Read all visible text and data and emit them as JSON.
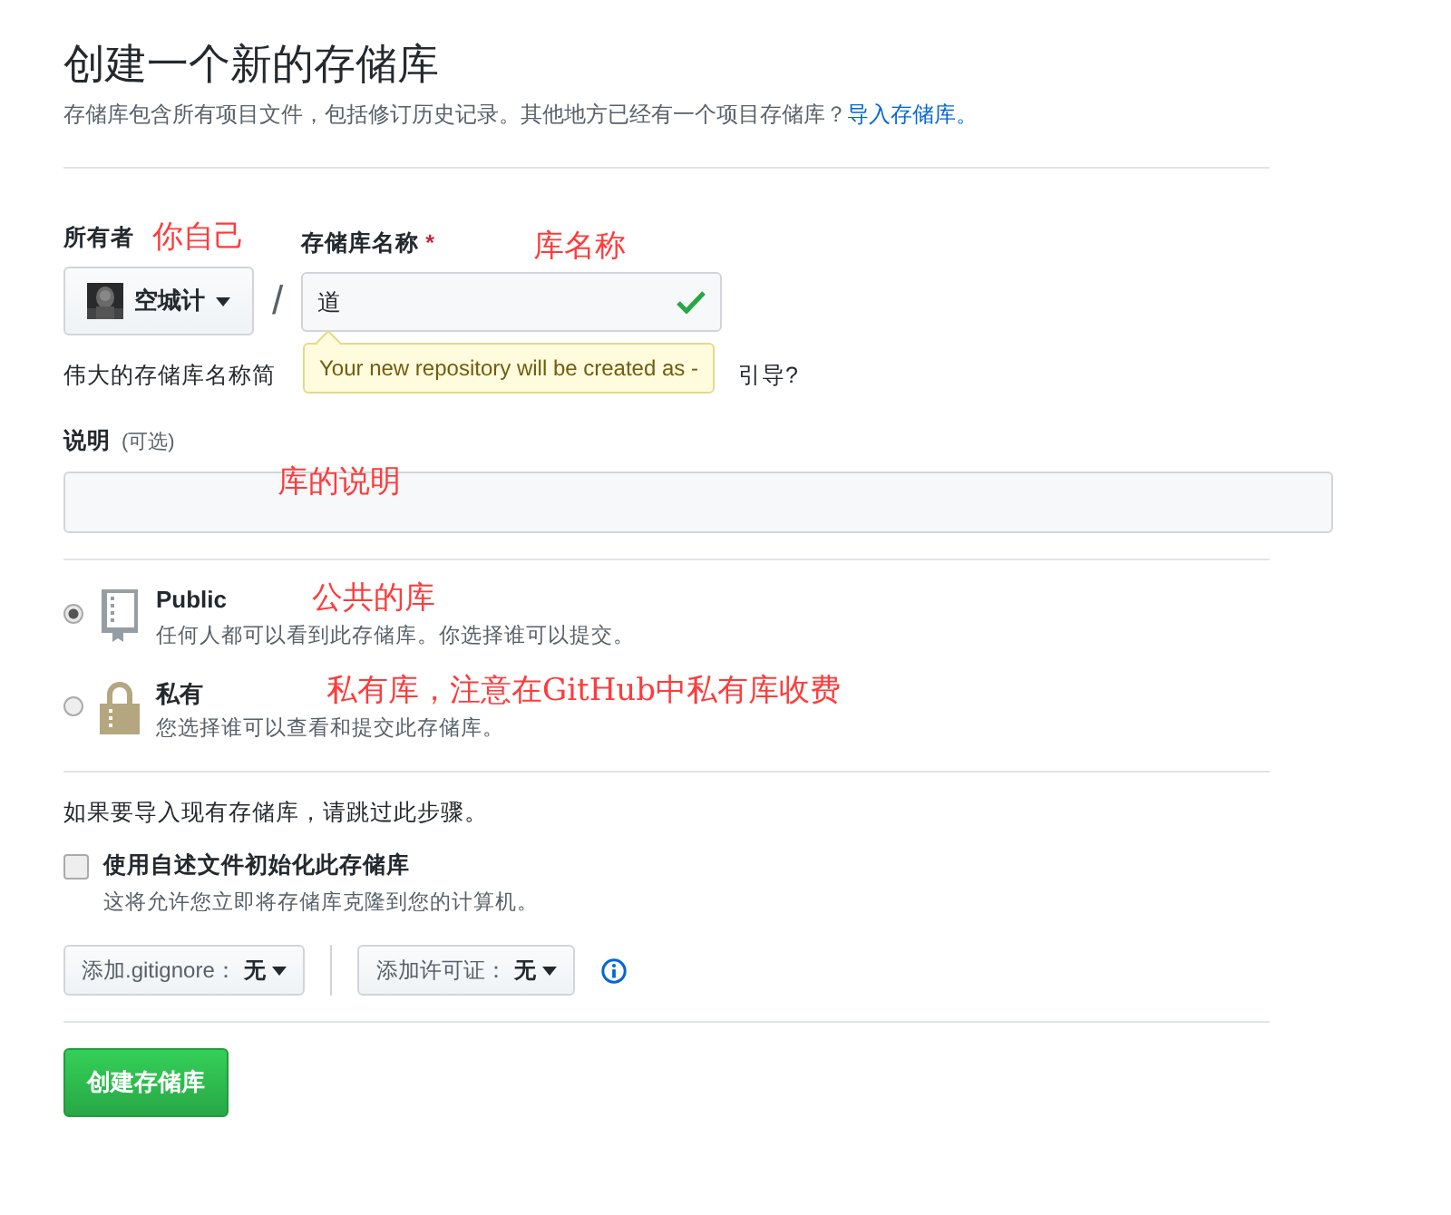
{
  "header": {
    "title": "创建一个新的存储库",
    "subtitle": "存储库包含所有项目文件，包括修订历史记录。其他地方已经有一个项目存储库？",
    "link": "导入存储库。"
  },
  "owner": {
    "label": "所有者",
    "value": "空城计"
  },
  "separator": "/",
  "repo_name": {
    "label": "存储库名称",
    "required_mark": "*",
    "value": "道",
    "valid": true
  },
  "tooltip": "Your new repository will be created as -",
  "name_hint": {
    "start": "伟大的存储库名称简",
    "end": "引导?"
  },
  "description": {
    "label": "说明",
    "optional": "(可选)"
  },
  "visibility": [
    {
      "kind": "public",
      "title": "Public",
      "description": "任何人都可以看到此存储库。你选择谁可以提交。",
      "selected": true
    },
    {
      "kind": "private",
      "title": "私有",
      "description": "您选择谁可以查看和提交此存储库。",
      "selected": false
    }
  ],
  "import_note": "如果要导入现有存储库，请跳过此步骤。",
  "readme": {
    "label": "使用自述文件初始化此存储库",
    "description": "这将允许您立即将存储库克隆到您的计算机。",
    "checked": false
  },
  "dropdowns": [
    {
      "label": "添加.gitignore：",
      "value": "无"
    },
    {
      "label": "添加许可证：",
      "value": "无"
    }
  ],
  "submit": "创建存储库",
  "annotations": [
    "你自己",
    "库名称",
    "库的说明",
    "公共的库",
    "私有库，注意在GitHub中私有库收费"
  ]
}
